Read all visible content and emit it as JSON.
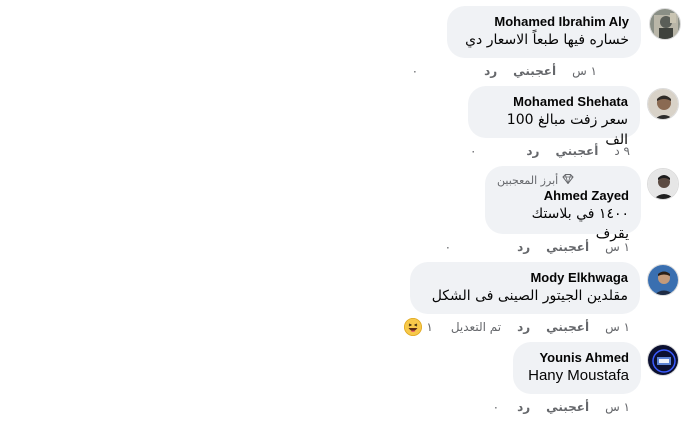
{
  "comments": [
    {
      "author": "Mohamed Ibrahim Aly",
      "text": "خساره فيها طبعاً الاسعار دي",
      "time": "١ س",
      "like": "أعجبني",
      "reply": "رد",
      "reactions": "٠"
    },
    {
      "author": "Mohamed Shehata",
      "text": "سعر زفت مبالغ 100 الف",
      "time": "٩ د",
      "like": "أعجبني",
      "reply": "رد",
      "reactions": "٠"
    },
    {
      "badge": "أبرز المعجبين",
      "author": "Ahmed Zayed",
      "text": "١٤٠٠ في بلاستك يقرف",
      "time": "١ س",
      "like": "أعجبني",
      "reply": "رد",
      "reactions": "٠"
    },
    {
      "author": "Mody Elkhwaga",
      "text": "مقلدين الجيتور الصينى فى الشكل",
      "time": "١ س",
      "like": "أعجبني",
      "reply": "رد",
      "edited": "تم التعديل",
      "reactions": "١"
    },
    {
      "author": "Younis Ahmed",
      "text": "Hany Moustafa",
      "time": "١ س",
      "like": "أعجبني",
      "reply": "رد",
      "reactions": "٠"
    }
  ]
}
